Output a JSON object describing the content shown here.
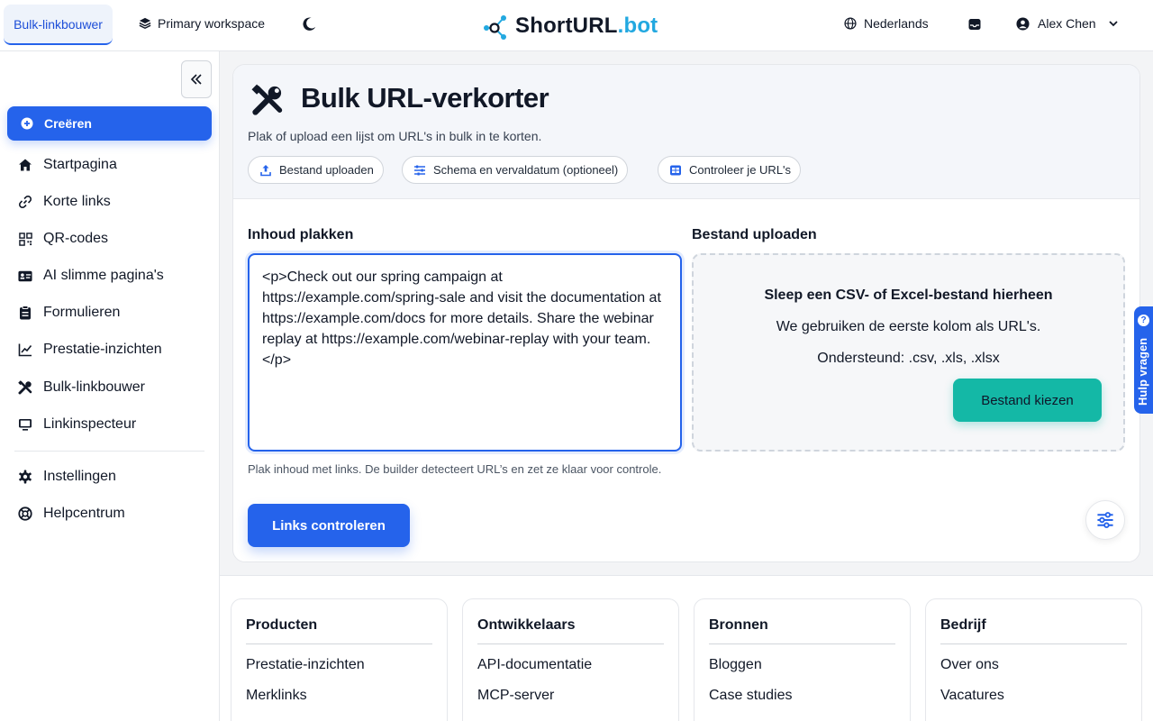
{
  "header": {
    "active_tab": "Bulk-linkbouwer",
    "workspace": "Primary workspace",
    "logo_main": "ShortURL",
    "logo_tld": ".bot",
    "language": "Nederlands",
    "user_name": "Alex Chen"
  },
  "sidebar": {
    "create_label": "Creëren",
    "items": [
      {
        "label": "Startpagina",
        "icon": "home-icon"
      },
      {
        "label": "Korte links",
        "icon": "link-icon"
      },
      {
        "label": "QR-codes",
        "icon": "qr-icon"
      },
      {
        "label": "AI slimme pagina's",
        "icon": "id-card-icon"
      },
      {
        "label": "Formulieren",
        "icon": "clipboard-icon"
      },
      {
        "label": "Prestatie-inzichten",
        "icon": "chart-icon"
      },
      {
        "label": "Bulk-linkbouwer",
        "icon": "tools-icon"
      },
      {
        "label": "Linkinspecteur",
        "icon": "monitor-icon"
      }
    ],
    "bottom_items": [
      {
        "label": "Instellingen",
        "icon": "gear-icon"
      },
      {
        "label": "Helpcentrum",
        "icon": "lifebuoy-icon"
      }
    ]
  },
  "main": {
    "title": "Bulk URL-verkorter",
    "subtitle": "Plak of upload een lijst om URL's in bulk in te korten.",
    "chips": [
      {
        "label": "Bestand uploaden",
        "icon": "upload-icon"
      },
      {
        "label": "Schema en vervaldatum (optioneel)",
        "icon": "sliders-icon"
      },
      {
        "label": "Controleer je URL's",
        "icon": "grid-icon"
      }
    ],
    "paste_label": "Inhoud plakken",
    "paste_value": "<p>Check out our spring campaign at https://example.com/spring-sale and visit the documentation at https://example.com/docs for more details. Share the webinar replay at https://example.com/webinar-replay with your team.</p>",
    "paste_hint": "Plak inhoud met links. De builder detecteert URL’s en zet ze klaar voor controle.",
    "check_button": "Links controleren",
    "upload_label": "Bestand uploaden",
    "dropzone_title": "Sleep een CSV- of Excel-bestand hierheen",
    "dropzone_line1": "We gebruiken de eerste kolom als URL's.",
    "dropzone_line2": "Ondersteund: .csv, .xls, .xlsx",
    "choose_button": "Bestand kiezen"
  },
  "help_tab": "Hulp vragen",
  "footer": {
    "columns": [
      {
        "title": "Producten",
        "links": [
          "Prestatie-inzichten",
          "Merklinks"
        ]
      },
      {
        "title": "Ontwikkelaars",
        "links": [
          "API-documentatie",
          "MCP-server"
        ]
      },
      {
        "title": "Bronnen",
        "links": [
          "Bloggen",
          "Case studies"
        ]
      },
      {
        "title": "Bedrijf",
        "links": [
          "Over ons",
          "Vacatures"
        ]
      }
    ]
  },
  "colors": {
    "primary": "#2563eb",
    "teal": "#14b8a6",
    "logo_accent": "#22a8e0"
  }
}
